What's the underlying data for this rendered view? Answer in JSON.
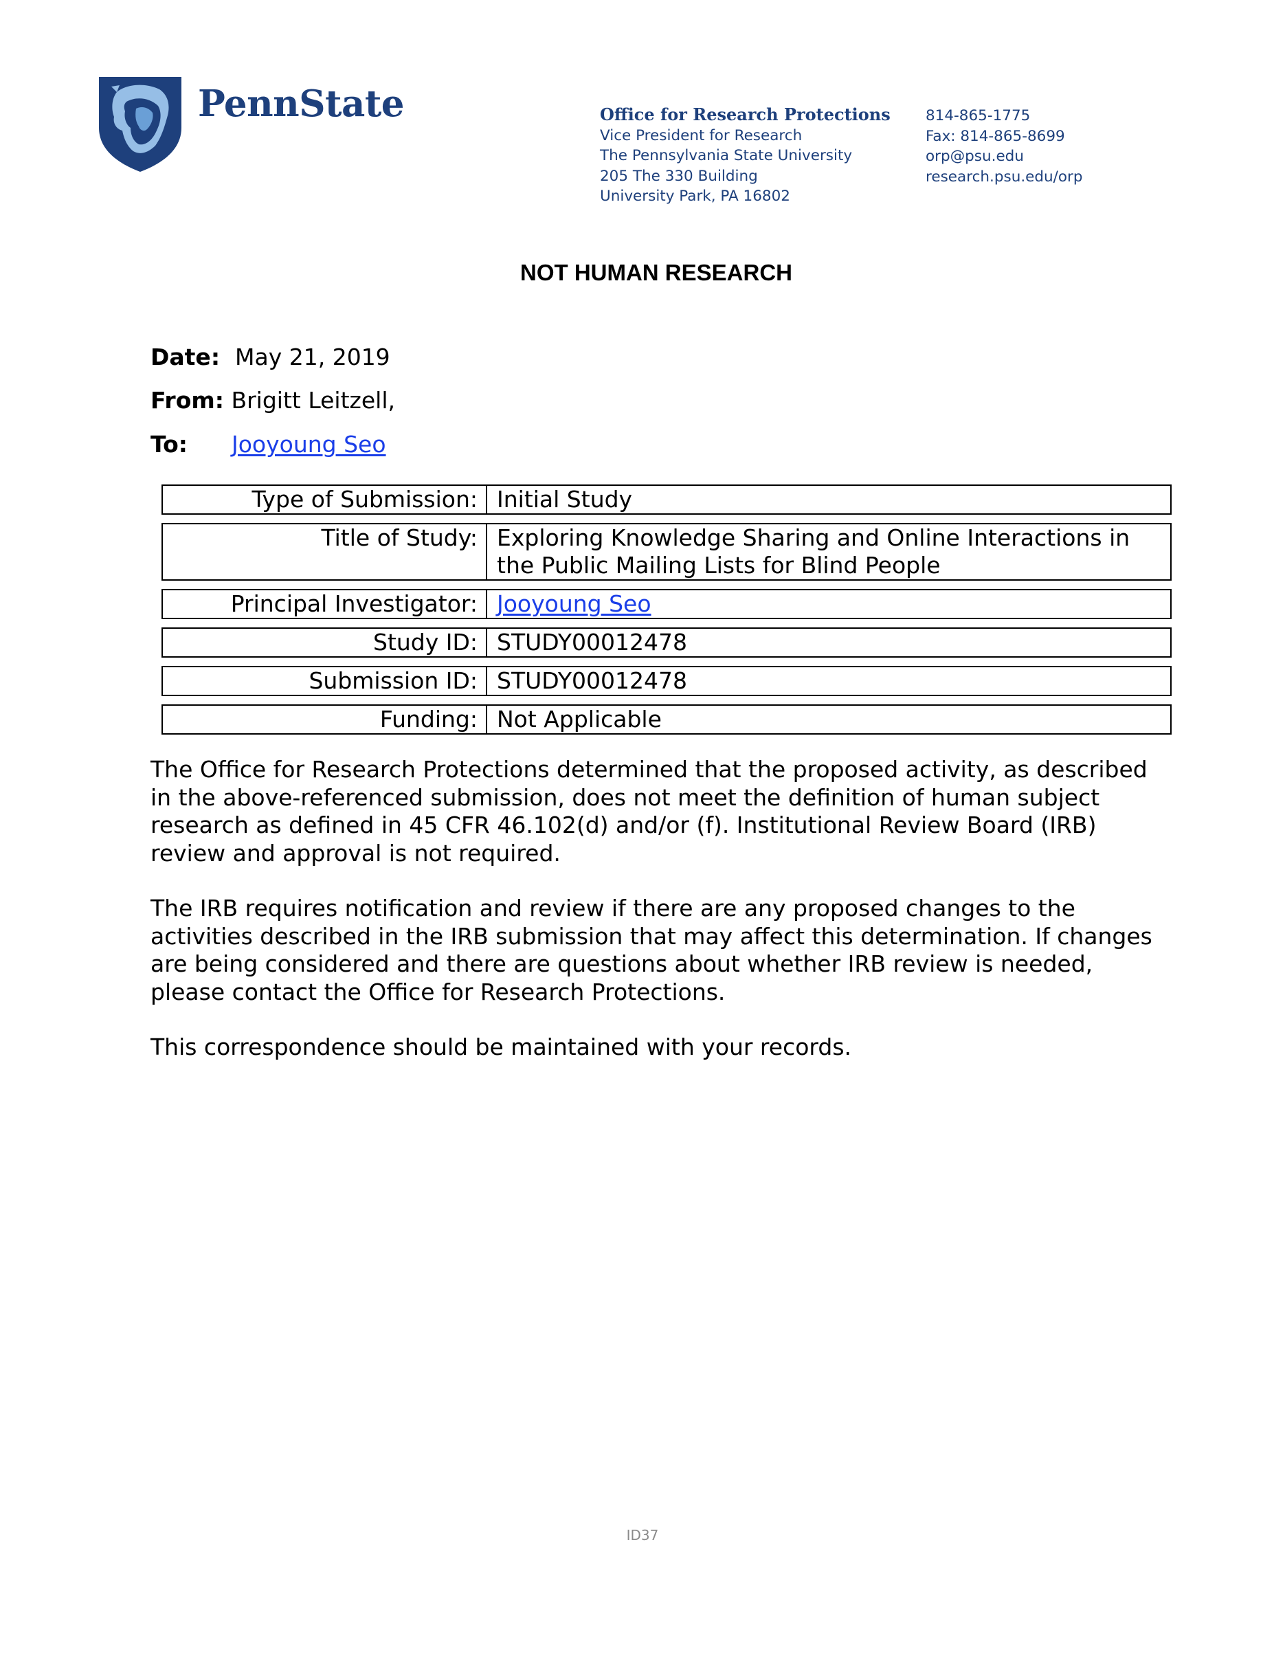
{
  "letterhead": {
    "wordmark": "PennState",
    "office_name": "Office for Research Protections",
    "address_lines": [
      "Vice President for Research",
      "The Pennsylvania State University",
      "205 The 330 Building",
      "University Park, PA 16802"
    ],
    "contact_lines": [
      "814-865-1775",
      "Fax: 814-865-8699",
      "orp@psu.edu",
      "research.psu.edu/orp"
    ],
    "colors": {
      "brand_blue": "#1e407c",
      "shield_light": "#96bee6",
      "shield_mid": "#6a9fd6"
    }
  },
  "title": "NOT HUMAN RESEARCH",
  "meta": {
    "date_label": "Date:",
    "date_value": "May 21, 2019",
    "from_label": "From:",
    "from_value": "Brigitt Leitzell,",
    "to_label": "To:",
    "to_value": "Jooyoung Seo"
  },
  "details": [
    {
      "label": "Type of Submission:",
      "value": "Initial Study"
    },
    {
      "label": "Title of Study:",
      "value": "Exploring Knowledge Sharing and Online Interactions in the Public Mailing Lists for Blind People"
    },
    {
      "label": "Principal Investigator:",
      "value": "Jooyoung Seo"
    },
    {
      "label": "Study ID:",
      "value": "STUDY00012478"
    },
    {
      "label": "Submission ID:",
      "value": "STUDY00012478"
    },
    {
      "label": "Funding:",
      "value": "Not Applicable"
    }
  ],
  "paragraphs": [
    "The Office for Research Protections determined that the proposed activity, as described in the above-referenced submission, does not meet the definition of human subject research as defined in 45 CFR 46.102(d) and/or (f). Institutional Review Board (IRB) review and approval is not required.",
    "The IRB requires notification and review if there are any proposed changes to the activities described in the IRB submission that may affect this determination. If changes are being considered and there are questions about whether IRB review is needed, please contact the Office for Research Protections.",
    "This correspondence should be maintained with your records."
  ],
  "footer_id": "ID37"
}
